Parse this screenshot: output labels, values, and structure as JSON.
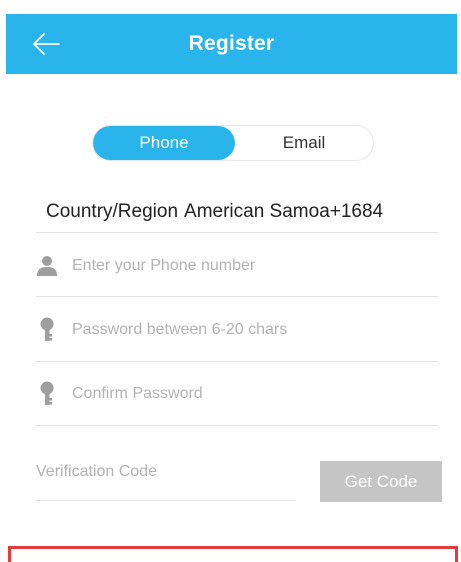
{
  "header": {
    "title": "Register",
    "background_color": "#2ab4ec",
    "back_icon": "arrow-left-icon"
  },
  "segment": {
    "phone_label": "Phone",
    "email_label": "Email",
    "selected": "Phone",
    "accent_color": "#2ab4ec"
  },
  "country": {
    "label": "Country/Region",
    "value": "American Samoa+1684"
  },
  "fields": {
    "phone": {
      "placeholder": "Enter your Phone number",
      "value": "",
      "icon": "user-icon"
    },
    "password": {
      "placeholder": "Password between 6-20 chars",
      "value": "",
      "icon": "key-icon"
    },
    "confirm": {
      "placeholder": "Confirm Password",
      "value": "",
      "icon": "key-icon"
    },
    "verification": {
      "placeholder": "Verification Code",
      "value": ""
    }
  },
  "get_code_label": "Get Code",
  "highlight_color": "#e53a3a"
}
